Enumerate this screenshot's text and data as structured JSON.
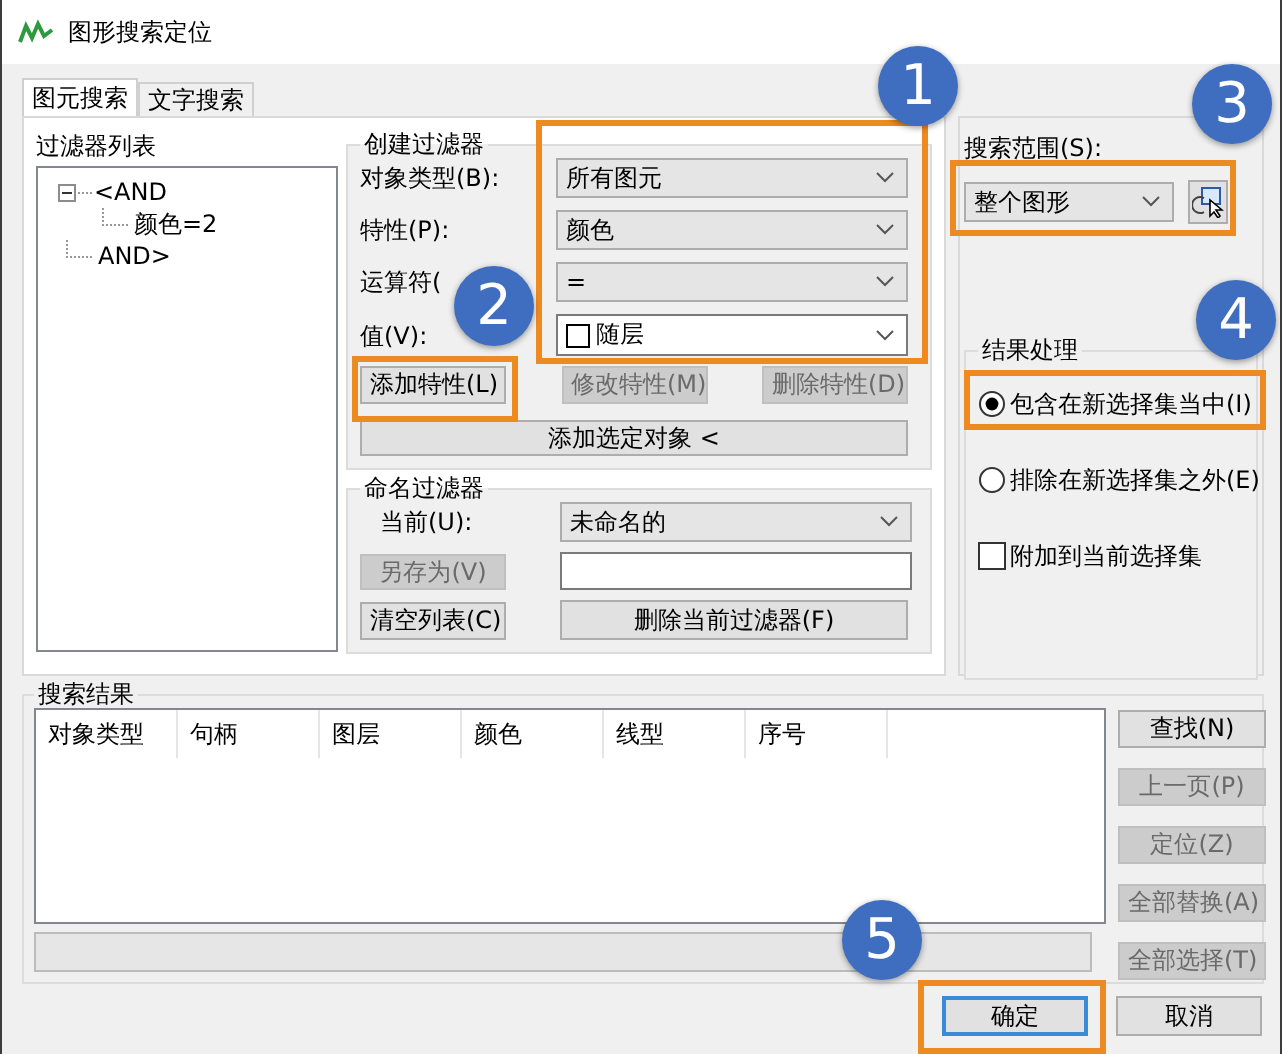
{
  "window": {
    "title": "图形搜索定位"
  },
  "tabs": [
    {
      "label": "图元搜索",
      "selected": true
    },
    {
      "label": "文字搜索",
      "selected": false
    }
  ],
  "filter_list": {
    "title": "过滤器列表",
    "tree": [
      {
        "label": "<AND",
        "expanded": true,
        "children": [
          {
            "label": "颜色=2"
          }
        ]
      },
      {
        "label": "AND>"
      }
    ]
  },
  "create_filter": {
    "title": "创建过滤器",
    "fields": [
      {
        "label": "对象类型(B):",
        "value": "所有图元",
        "kind": "combo"
      },
      {
        "label": "特性(P):",
        "value": "颜色",
        "kind": "combo"
      },
      {
        "label": "运算符(",
        "value": "=",
        "kind": "combo"
      },
      {
        "label": "值(V):",
        "value": "随层",
        "kind": "color"
      }
    ],
    "buttons": [
      {
        "label": "添加特性(L)",
        "disabled": false
      },
      {
        "label": "修改特性(M)",
        "disabled": true
      },
      {
        "label": "删除特性(D)",
        "disabled": true
      }
    ],
    "add_selected_button": "添加选定对象 <"
  },
  "named_filter": {
    "title": "命名过滤器",
    "current_label": "当前(U):",
    "current_value": "未命名的",
    "save_as_button": {
      "label": "另存为(V)",
      "disabled": true
    },
    "clear_button": "清空列表(C)",
    "delete_button": "删除当前过滤器(F)"
  },
  "search_scope": {
    "label": "搜索范围(S):",
    "value": "整个图形"
  },
  "result_handling": {
    "title": "结果处理",
    "options": [
      {
        "kind": "radio",
        "label": "包含在新选择集当中(I)",
        "selected": true
      },
      {
        "kind": "radio",
        "label": "排除在新选择集之外(E)",
        "selected": false
      },
      {
        "kind": "checkbox",
        "label": "附加到当前选择集",
        "checked": false
      }
    ]
  },
  "search_results": {
    "title": "搜索结果",
    "columns": [
      "对象类型",
      "句柄",
      "图层",
      "颜色",
      "线型",
      "序号"
    ],
    "progress": {
      "level": 0
    },
    "buttons": [
      {
        "label": "查找(N)",
        "disabled": false
      },
      {
        "label": "上一页(P)",
        "disabled": true
      },
      {
        "label": "定位(Z)",
        "disabled": true
      },
      {
        "label": "全部替换(A)",
        "disabled": true
      },
      {
        "label": "全部选择(T)",
        "disabled": true
      }
    ]
  },
  "footer_buttons": [
    {
      "label": "确定",
      "default": true
    },
    {
      "label": "取消",
      "default": false
    }
  ],
  "callouts": [
    "1",
    "2",
    "3",
    "4",
    "5"
  ]
}
